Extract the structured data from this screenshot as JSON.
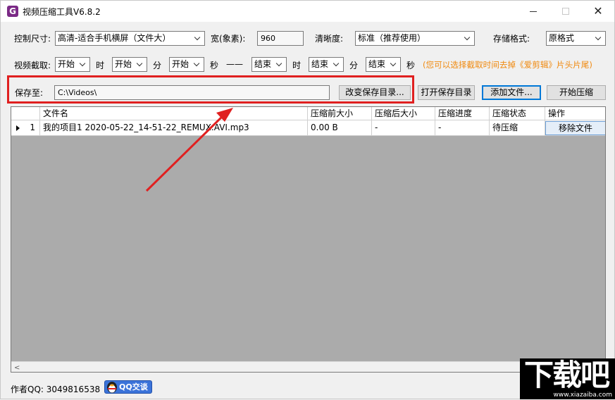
{
  "window": {
    "title": "视频压缩工具V6.8.2",
    "icon_glyph": "G",
    "controls": {
      "minimize": "—",
      "maximize": "□",
      "close": "✕"
    }
  },
  "settings": {
    "size_label": "控制尺寸:",
    "size_value": "高清-适合手机横屏（文件大）",
    "width_label": "宽(象素):",
    "width_value": "960",
    "clarity_label": "清晰度:",
    "clarity_value": "标准（推荐使用）",
    "format_label": "存储格式:",
    "format_value": "原格式"
  },
  "clip": {
    "label": "视频截取:",
    "start_hour": "开始",
    "hour_unit": "时",
    "start_min": "开始",
    "min_unit": "分",
    "start_sec": "开始",
    "sec_unit": "秒",
    "dash": "——",
    "end_hour": "结束",
    "end_hour_unit": "时",
    "end_min": "结束",
    "end_min_unit": "分",
    "end_sec": "结束",
    "end_sec_unit": "秒",
    "hint": "(您可以选择截取时间去掉《爱剪辑》片头片尾)"
  },
  "save": {
    "label": "保存至:",
    "path": "C:\\Videos\\",
    "change_dir": "改变保存目录...",
    "open_dir": "打开保存目录",
    "add_files": "添加文件...",
    "start": "开始压缩"
  },
  "table": {
    "columns": [
      "文件名",
      "压缩前大小",
      "压缩后大小",
      "压缩进度",
      "压缩状态",
      "操作"
    ],
    "rows": [
      {
        "index": "1",
        "filename": "我的项目1 2020-05-22_14-51-22_REMUX.AVI.mp3",
        "size_before": "0.00 B",
        "size_after": "-",
        "progress": "-",
        "status": "待压缩",
        "action": "移除文件"
      }
    ]
  },
  "footer": {
    "author": "作者QQ: 3049816538",
    "qq_badge": "QQ交谈"
  },
  "watermark": {
    "text": "下载吧",
    "url": "www.xiazaiba.com"
  },
  "colors": {
    "annotation": "#e02020",
    "hint": "#f08a10",
    "grid_background": "#ababab"
  }
}
